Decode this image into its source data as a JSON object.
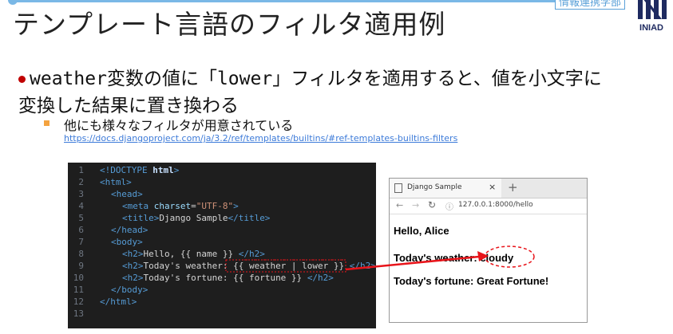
{
  "header": {
    "tag": "情報連携学部",
    "logo_text": "INIAD",
    "title": "テンプレート言語のフィルタ適用例"
  },
  "bullet": {
    "w1": "weather",
    "t1": "変数の値に「",
    "w2": "lower",
    "t2": "」フィルタを適用すると、値を小文字に",
    "line2": "変換した結果に置き換わる"
  },
  "subbullet": {
    "text": "他にも様々なフィルタが用意されている",
    "link": "https://docs.djangoproject.com/ja/3.2/ref/templates/builtins/#ref-templates-builtins-filters"
  },
  "code": {
    "line_numbers": [
      "1",
      "2",
      "3",
      "4",
      "5",
      "6",
      "7",
      "8",
      "9",
      "10",
      "11",
      "12",
      "13"
    ],
    "l1": {
      "a": "<!DOCTYPE ",
      "b": "html",
      "c": ">"
    },
    "l2": {
      "a": "<html>"
    },
    "l3": {
      "a": "<head>"
    },
    "l4": {
      "a": "<meta ",
      "b": "charset",
      "c": "=",
      "d": "\"UTF-8\"",
      "e": ">"
    },
    "l5": {
      "a": "<title>",
      "b": "Django Sample",
      "c": "</title>"
    },
    "l6": {
      "a": "</head>"
    },
    "l7": {
      "a": "<body>"
    },
    "l8": {
      "a": "<h2>",
      "b": "Hello, {{ name }} ",
      "c": "</h2>"
    },
    "l9": {
      "a": "<h2>",
      "b": "Today's weather: {{ weather | lower }} ",
      "c": "</h2>"
    },
    "l10": {
      "a": "<h2>",
      "b": "Today's fortune: {{ fortune }} ",
      "c": "</h2>"
    },
    "l11": {
      "a": "</body>"
    },
    "l12": {
      "a": "</html>"
    }
  },
  "browser": {
    "tab_title": "Django Sample",
    "tab_close": "×",
    "new_tab": "+",
    "back": "←",
    "forward": "→",
    "reload": "↻",
    "info": "ⓘ",
    "url": "127.0.0.1:8000/hello",
    "hello": "Hello, Alice",
    "weather_prefix": "Today's weather: ",
    "weather_value": "cloudy",
    "fortune": "Today's fortune: Great Fortune!"
  },
  "colors": {
    "bullet_dot": "#c00000",
    "sub_square": "#f4a340",
    "accent_line": "#7ab8e6",
    "annotation_red": "#e8141a",
    "link": "#3d7bd9"
  }
}
